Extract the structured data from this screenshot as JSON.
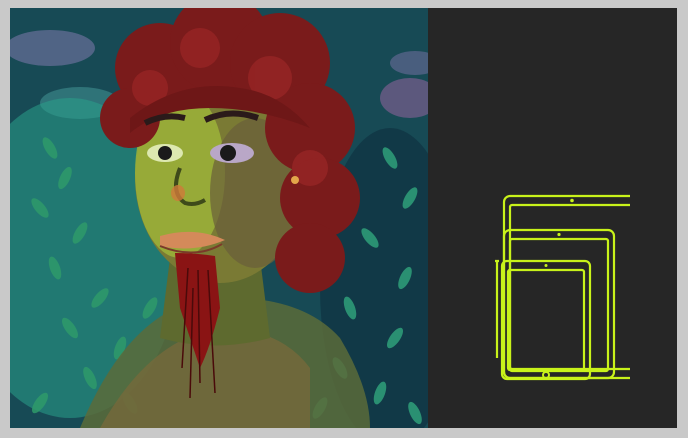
{
  "artwork": {
    "icon": "portrait-painting",
    "colors": {
      "background_teal": "#1f6d6a",
      "hair_red": "#7a1b1b",
      "skin_green": "#8fa63a",
      "foliage": "#2f9a6a",
      "beard_red": "#8a1414"
    }
  },
  "panel": {
    "background": "#262626",
    "icon": "tablet-sizes-icon",
    "icon_color": "#c8f21a"
  }
}
